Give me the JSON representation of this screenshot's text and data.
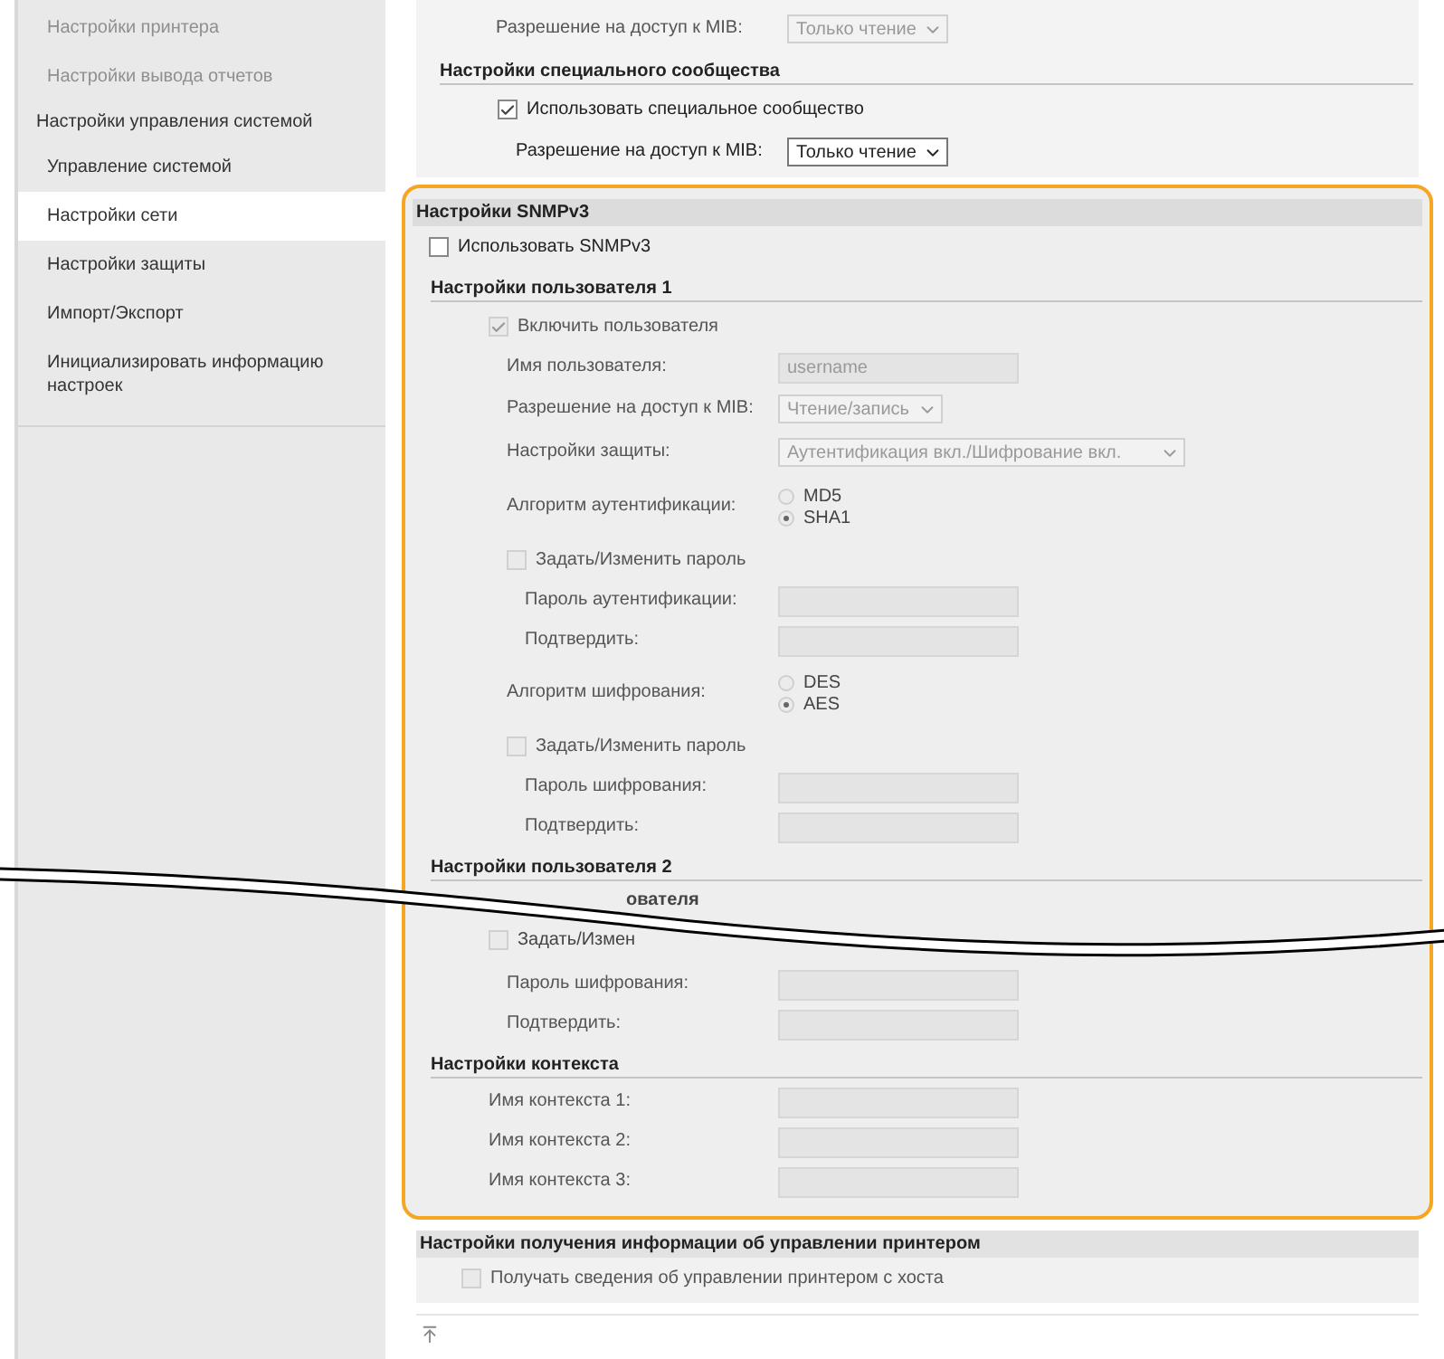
{
  "sidebar": {
    "items": [
      {
        "label": "Настройки принтера",
        "kind": "item",
        "faded": true,
        "selected": false
      },
      {
        "label": "Настройки вывода отчетов",
        "kind": "item",
        "faded": true,
        "selected": false
      },
      {
        "label": "Настройки управления системой",
        "kind": "group",
        "faded": false,
        "selected": false
      },
      {
        "label": "Управление системой",
        "kind": "item",
        "faded": false,
        "selected": false
      },
      {
        "label": "Настройки сети",
        "kind": "item",
        "faded": false,
        "selected": true
      },
      {
        "label": "Настройки защиты",
        "kind": "item",
        "faded": false,
        "selected": false
      },
      {
        "label": "Импорт/Экспорт",
        "kind": "item",
        "faded": false,
        "selected": false
      },
      {
        "label": "Инициализировать информацию настроек",
        "kind": "item",
        "faded": false,
        "selected": false
      }
    ]
  },
  "top_section": {
    "rows": [
      {
        "kind": "select",
        "label": "Разрешение на доступ к MIB:",
        "value": "Только чтение",
        "disabled": true
      },
      {
        "kind": "subheading",
        "label": "Настройки специального сообщества",
        "children": [
          {
            "kind": "checkbox",
            "label": "Использовать специальное сообщество",
            "checked": true,
            "disabled": false,
            "children": [
              {
                "kind": "select",
                "label": "Разрешение на доступ к MIB:",
                "value": "Только чтение",
                "disabled": false
              }
            ]
          }
        ]
      }
    ]
  },
  "snmpv3": {
    "title": "Настройки SNMPv3",
    "rows": [
      {
        "kind": "checkbox",
        "label": "Использовать SNMPv3",
        "checked": false,
        "disabled": false
      },
      {
        "kind": "subheading",
        "label": "Настройки пользователя 1",
        "children": [
          {
            "kind": "checkbox",
            "label": "Включить пользователя",
            "checked": true,
            "disabled": true,
            "children": [
              {
                "kind": "field",
                "label": "Имя пользователя:",
                "value": "username",
                "disabled": true
              },
              {
                "kind": "select",
                "label": "Разрешение на доступ к MIB:",
                "value": "Чтение/запись",
                "disabled": true
              },
              {
                "kind": "select",
                "label": "Настройки защиты:",
                "value": "Аутентификация вкл./Шифрование вкл.",
                "disabled": true,
                "wide": true
              },
              {
                "kind": "radio",
                "label": "Алгоритм аутентификации:",
                "disabled": true,
                "options": [
                  {
                    "label": "MD5",
                    "selected": false
                  },
                  {
                    "label": "SHA1",
                    "selected": true
                  }
                ]
              },
              {
                "kind": "checkbox",
                "label": "Задать/Изменить пароль",
                "checked": false,
                "disabled": true,
                "children": [
                  {
                    "kind": "field",
                    "label": "Пароль аутентификации:",
                    "disabled": true
                  },
                  {
                    "kind": "field",
                    "label": "Подтвердить:",
                    "disabled": true
                  }
                ]
              },
              {
                "kind": "radio",
                "label": "Алгоритм шифрования:",
                "disabled": true,
                "options": [
                  {
                    "label": "DES",
                    "selected": false
                  },
                  {
                    "label": "AES",
                    "selected": true
                  }
                ]
              },
              {
                "kind": "checkbox",
                "label": "Задать/Изменить пароль",
                "checked": false,
                "disabled": true,
                "children": [
                  {
                    "kind": "field",
                    "label": "Пароль шифрования:",
                    "disabled": true
                  },
                  {
                    "kind": "field",
                    "label": "Подтвердить:",
                    "disabled": true
                  }
                ]
              }
            ]
          }
        ]
      },
      {
        "kind": "subheading",
        "label": "Настройки пользователя 2",
        "break": true,
        "children": [
          {
            "kind": "fragment",
            "label": "ователя"
          },
          {
            "kind": "cutcheckbox",
            "label": "Задать/Измен",
            "checked": false,
            "disabled": true,
            "children": [
              {
                "kind": "field",
                "label": "Пароль шифрования:",
                "disabled": true
              },
              {
                "kind": "field",
                "label": "Подтвердить:",
                "disabled": true
              }
            ]
          }
        ]
      },
      {
        "kind": "subheading",
        "label": "Настройки контекста",
        "children": [
          {
            "kind": "field",
            "label": "Имя контекста 1:",
            "disabled": true
          },
          {
            "kind": "field",
            "label": "Имя контекста 2:",
            "disabled": true
          },
          {
            "kind": "field",
            "label": "Имя контекста 3:",
            "disabled": true
          }
        ]
      }
    ]
  },
  "printer_info": {
    "title": "Настройки получения информации об управлении принтером",
    "rows": [
      {
        "kind": "checkbox",
        "label": "Получать сведения об управлении принтером с хоста",
        "checked": false,
        "disabled": true
      }
    ]
  }
}
